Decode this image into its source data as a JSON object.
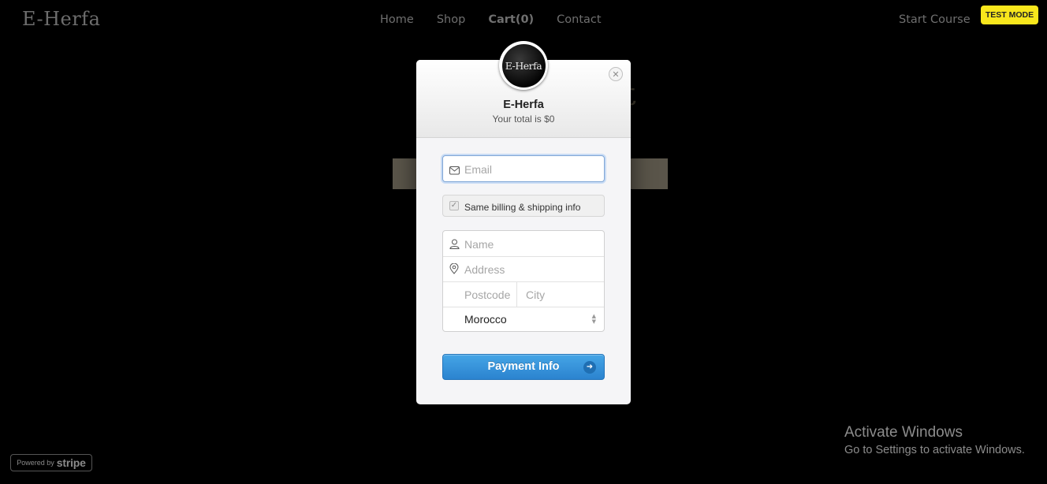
{
  "site": {
    "logo": "E-Herfa",
    "nav": [
      "Home",
      "Shop",
      "Cart(0)",
      "Contact"
    ],
    "start_course": "Start Course",
    "heading_fragment": "t"
  },
  "test_mode": "TEST MODE",
  "powered_by": {
    "prefix": "Powered by",
    "brand": "stripe"
  },
  "windows_notice": {
    "title": "Activate Windows",
    "subtitle": "Go to Settings to activate Windows."
  },
  "checkout": {
    "avatar_text": "E-Herfa",
    "store_name": "E-Herfa",
    "total_text": "Your total is $0",
    "email_placeholder": "Email",
    "same_billing_label": "Same billing & shipping info",
    "same_billing_checked": true,
    "name_placeholder": "Name",
    "address_placeholder": "Address",
    "postcode_placeholder": "Postcode",
    "city_placeholder": "City",
    "country_value": "Morocco",
    "submit_label": "Payment Info"
  },
  "colors": {
    "accent_blue": "#2b83cf",
    "test_badge": "#f8e71c",
    "backdrop": "#000000"
  },
  "icons": [
    "envelope-icon",
    "user-icon",
    "location-pin-icon",
    "close-icon",
    "arrow-right-icon"
  ]
}
